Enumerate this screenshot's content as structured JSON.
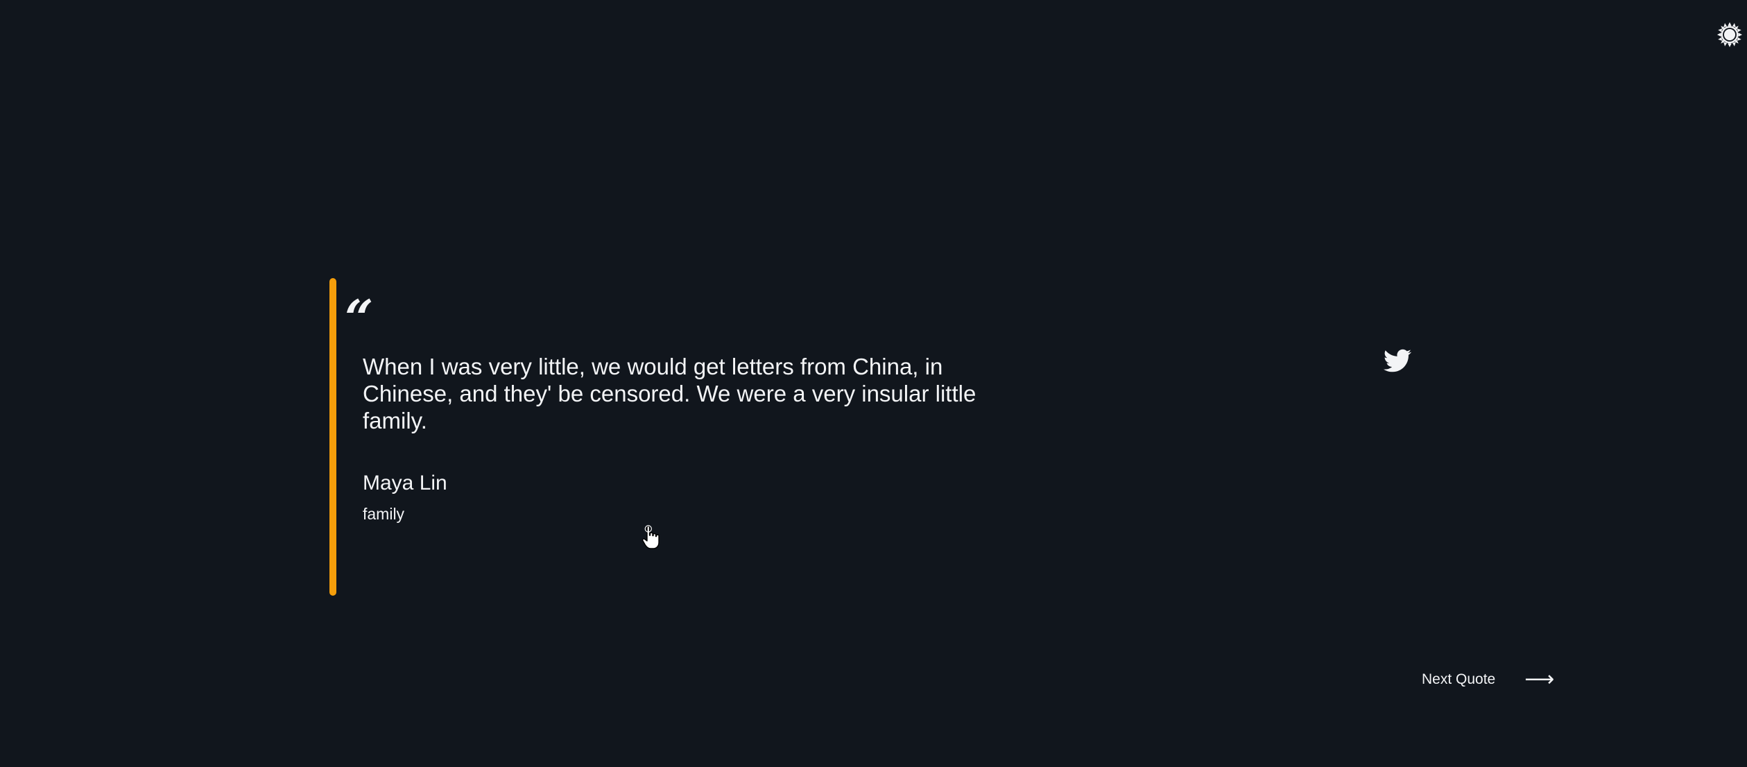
{
  "header": {
    "theme_toggle_icon": "sun-icon"
  },
  "quote": {
    "mark": "“",
    "text": "When I was very little, we would get letters from China, in Chinese, and they' be censored. We were a very insular little family.",
    "author": "Maya Lin",
    "tag": "family",
    "accent_color": "#f59e0b"
  },
  "actions": {
    "tweet_icon": "twitter-icon",
    "next_label": "Next Quote",
    "next_arrow": "⟶"
  },
  "colors": {
    "background": "#11161d",
    "text": "#f3f4f6",
    "accent": "#f59e0b"
  }
}
